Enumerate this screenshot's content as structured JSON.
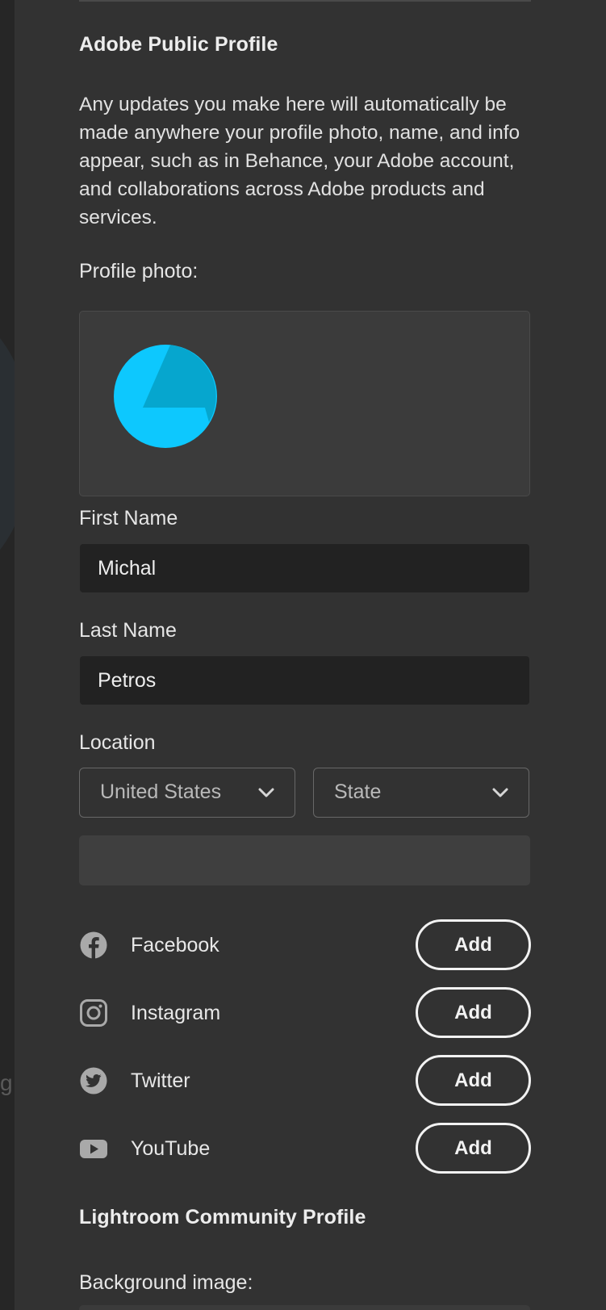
{
  "public_profile": {
    "heading": "Adobe Public Profile",
    "description": "Any updates you make here will automatically be made anywhere your profile photo, name, and info appear, such as in Behance, your Adobe account, and collaborations across Adobe products and services.",
    "profile_photo_label": "Profile photo:",
    "avatar_icon": "lightroom-aperture-avatar",
    "accent_color": "#0dc8fe"
  },
  "fields": {
    "first_name_label": "First Name",
    "first_name_value": "Michal",
    "last_name_label": "Last Name",
    "last_name_value": "Petros",
    "location_label": "Location",
    "country_value": "United States",
    "state_value": "State",
    "city_value": ""
  },
  "social": [
    {
      "label": "Facebook",
      "icon": "facebook-icon",
      "button": "Add"
    },
    {
      "label": "Instagram",
      "icon": "instagram-icon",
      "button": "Add"
    },
    {
      "label": "Twitter",
      "icon": "twitter-icon",
      "button": "Add"
    },
    {
      "label": "YouTube",
      "icon": "youtube-icon",
      "button": "Add"
    }
  ],
  "community_profile": {
    "heading": "Lightroom Community Profile",
    "background_image_label": "Background image:"
  },
  "colors": {
    "panel": "#323232",
    "field": "#222222",
    "text": "#e6e6e6"
  }
}
